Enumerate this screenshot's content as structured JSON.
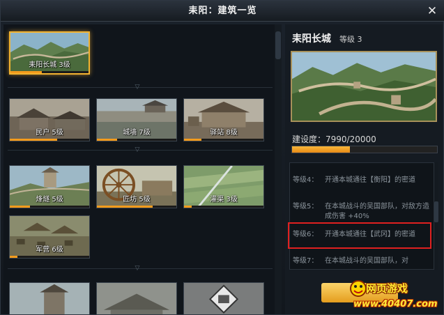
{
  "window": {
    "title": "耒阳：建筑一览"
  },
  "buildings": [
    {
      "name": "耒阳长城",
      "level": "3级",
      "progress": 0.4,
      "selected": true,
      "scene": "wall"
    },
    {
      "name": "民户",
      "level": "5级",
      "progress": 0.6,
      "scene": "house"
    },
    {
      "name": "城墙",
      "level": "7级",
      "progress": 0.25,
      "scene": "citywall"
    },
    {
      "name": "驿站",
      "level": "8级",
      "progress": 0.22,
      "scene": "station"
    },
    {
      "name": "烽燧",
      "level": "5级",
      "progress": 0.25,
      "scene": "beacon"
    },
    {
      "name": "匠坊",
      "level": "5级",
      "progress": 0.7,
      "scene": "workshop"
    },
    {
      "name": "灌渠",
      "level": "3级",
      "progress": 0.1,
      "scene": "canal"
    },
    {
      "name": "军营",
      "level": "6级",
      "progress": 0.1,
      "scene": "camp"
    }
  ],
  "detail": {
    "name": "耒阳长城",
    "level_label": "等级 3",
    "construction_label": "建设度：",
    "construction_value": "7990/20000",
    "construction_progress": 0.3995
  },
  "levels": [
    {
      "lv": "等级4：",
      "desc": "开通本城通往【衡阳】的密道"
    },
    {
      "lv": "等级5：",
      "desc": "在本城战斗的吴国部队，对敌方造成伤害 +40%"
    },
    {
      "lv": "等级6：",
      "desc": "开通本城通往【武冈】的密道"
    },
    {
      "lv": "等级7：",
      "desc": "在本城战斗的吴国部队，对"
    }
  ],
  "watermark": {
    "title": "网页游戏",
    "url": "www.40407.com"
  },
  "colors": {
    "accent": "#f39b1c",
    "highlight": "#e02020",
    "selected_border": "#f2b330"
  }
}
